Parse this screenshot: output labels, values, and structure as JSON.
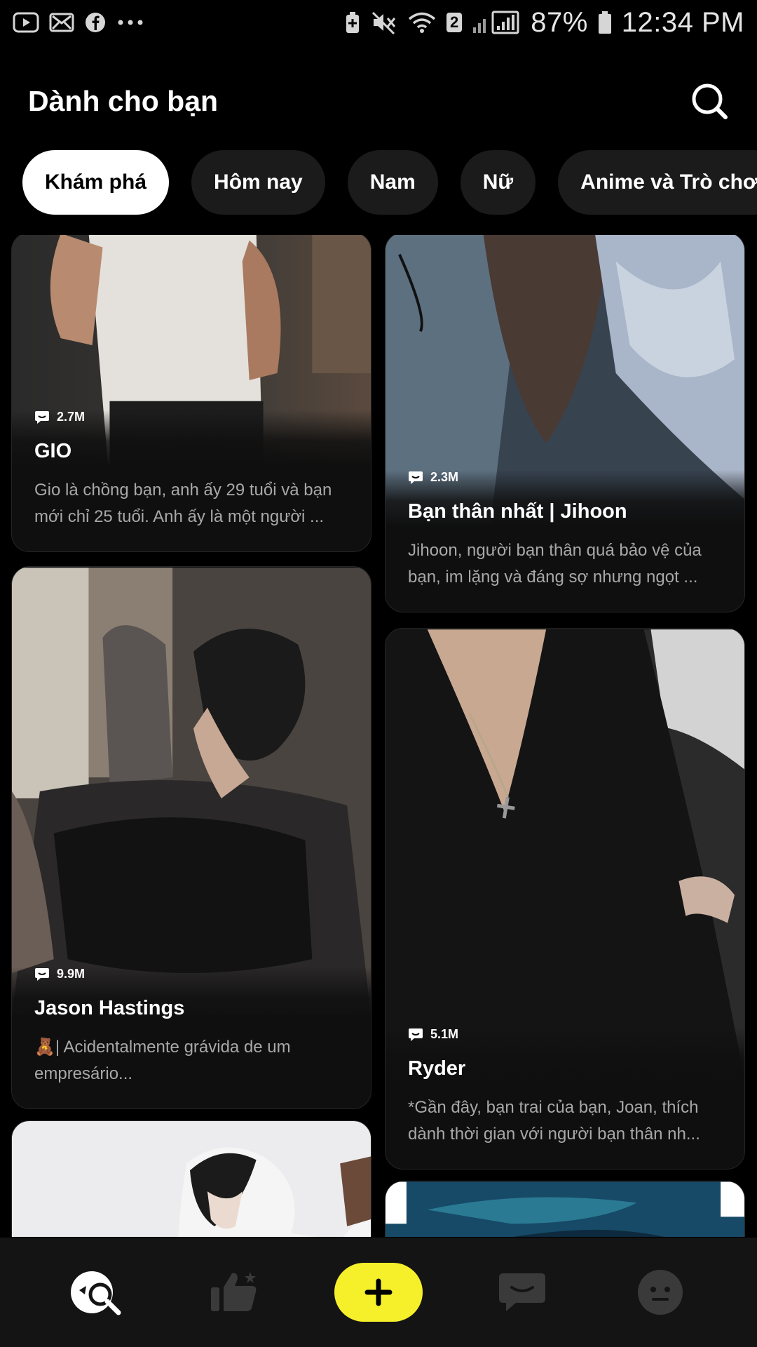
{
  "status_bar": {
    "battery_percent": "87%",
    "time": "12:34 PM",
    "sim_badge": "2",
    "left_icons": [
      "youtube-icon",
      "app-icon",
      "facebook-icon",
      "more-icon"
    ],
    "right_icons": [
      "battery-saver-icon",
      "mute-icon",
      "wifi-icon",
      "signal-icon",
      "battery-icon"
    ]
  },
  "header": {
    "title": "Dành cho bạn",
    "search_icon": "search-icon"
  },
  "chips": [
    "Khám phá",
    "Hôm nay",
    "Nam",
    "Nữ",
    "Anime và Trò chơi"
  ],
  "cards": [
    {
      "stat": "2.7M",
      "title": "GIO",
      "desc_lines": [
        "Gio là chồng bạn, anh ấy 29 tuổi và bạn",
        "mới chỉ 25 tuổi. Anh ấy là một người ..."
      ]
    },
    {
      "stat": "2.3M",
      "title": "Bạn thân nhất | Jihoon",
      "desc_lines": [
        "Jihoon, người bạn thân quá bảo vệ của",
        "bạn, im lặng và đáng sợ nhưng ngọt ..."
      ]
    },
    {
      "stat": "9.9M",
      "title": "Jason Hastings",
      "desc_lines": [
        "🧸| Acidentalmente grávida de um",
        "empresário..."
      ]
    },
    {
      "stat": "5.1M",
      "title": "Ryder",
      "desc_lines": [
        "*Gần đây, bạn trai của bạn, Joan, thích",
        "dành thời gian với người bạn thân nh..."
      ]
    }
  ],
  "bottom_nav": {
    "items": [
      "discover-icon",
      "like-icon",
      "create-icon",
      "chat-icon",
      "profile-icon"
    ],
    "create_color": "#f6f02a"
  }
}
